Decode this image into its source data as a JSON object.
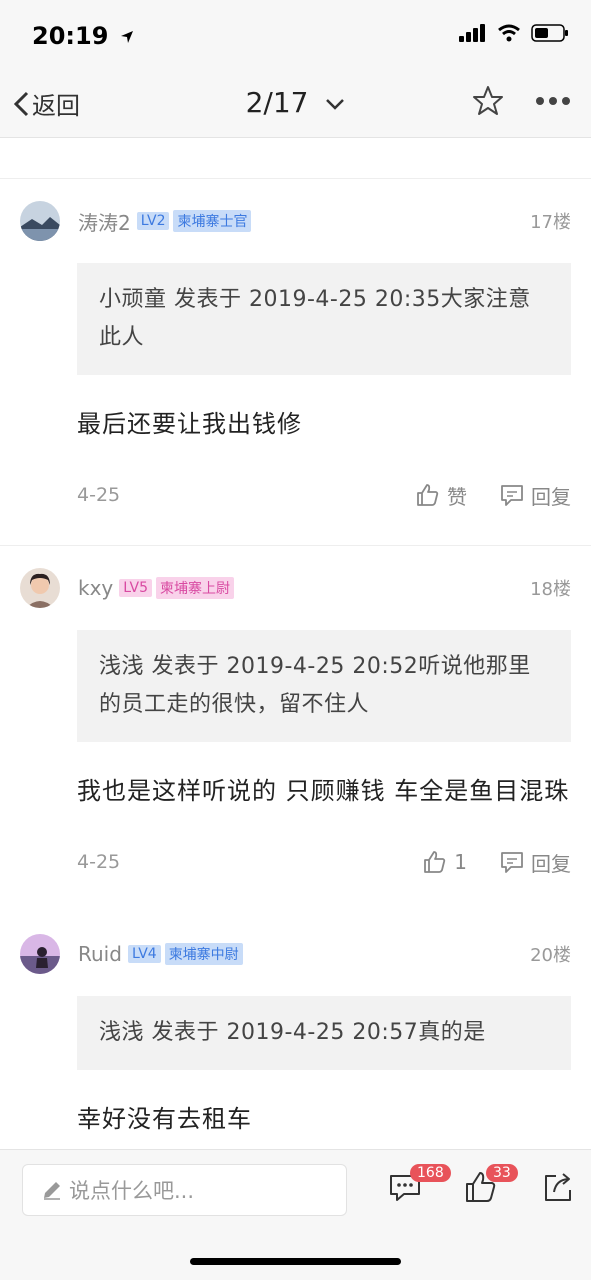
{
  "status": {
    "time": "20:19"
  },
  "nav": {
    "back_label": "返回",
    "page": "2/17"
  },
  "posts": [
    {
      "username": "涛涛2",
      "level": "LV2",
      "rank": "柬埔寨士官",
      "floor": "17楼",
      "quote": "小顽童 发表于 2019-4-25 20:35大家注意此人",
      "body": "最后还要让我出钱修",
      "date": "4-25",
      "like_label": "赞",
      "reply_label": "回复"
    },
    {
      "username": "kxy",
      "level": "LV5",
      "rank": "柬埔寨上尉",
      "floor": "18楼",
      "quote": "浅浅 发表于 2019-4-25 20:52听说他那里的员工走的很快，留不住人",
      "body": "我也是这样听说的 只顾赚钱 车全是鱼目混珠",
      "date": "4-25",
      "like_label": "1",
      "reply_label": "回复"
    },
    {
      "username": "Ruid",
      "level": "LV4",
      "rank": "柬埔寨中尉",
      "floor": "20楼",
      "quote": "浅浅 发表于 2019-4-25 20:57真的是",
      "body": "幸好没有去租车"
    }
  ],
  "bottom": {
    "input_placeholder": "说点什么吧...",
    "comment_count": "168",
    "like_count": "33"
  },
  "colors": {
    "badge_blue": "#3d7ae0",
    "badge_pink": "#d94aa2",
    "count_badge": "#e8535a"
  },
  "icons": [
    "location-arrow-icon",
    "signal-icon",
    "wifi-icon",
    "battery-icon",
    "back-chevron-icon",
    "chevron-down-icon",
    "star-icon",
    "more-icon",
    "thumbs-up-icon",
    "comment-icon",
    "pencil-icon",
    "share-icon"
  ]
}
